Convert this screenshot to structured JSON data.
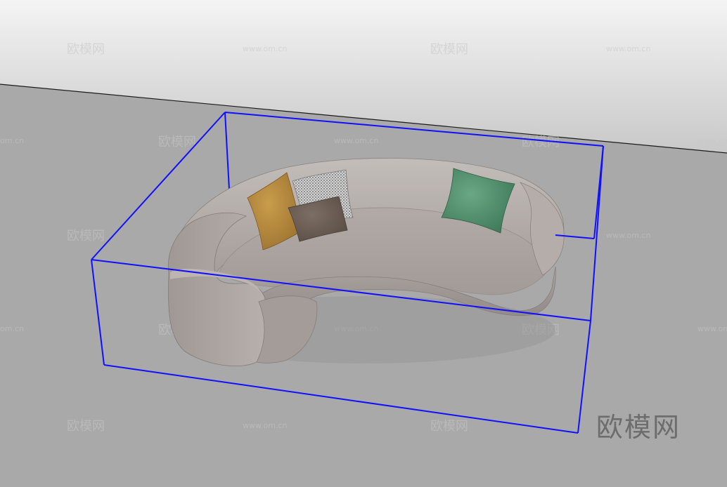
{
  "watermark": {
    "brand_text": "欧模网",
    "site_text": "www.om.cn",
    "edge_site_text": "om.cn"
  },
  "colors": {
    "sky_top": "#f3f3f3",
    "sky_bottom": "#cfcfcf",
    "ground": "#a9a9a9",
    "horizon_line": "#1a1a1a",
    "bounding_box": "#1010ff",
    "sofa_body": "#a69f9b",
    "sofa_light": "#bbb4b0",
    "sofa_dark": "#8f8884",
    "pillow_mustard": "#b5893c",
    "pillow_check": "#c9c9c9",
    "pillow_brown": "#6b5e55",
    "pillow_green": "#4f8f6c"
  },
  "icons": {
    "sofa": "curved-kidney-sofa",
    "selection": "bounding-box-wireframe"
  }
}
